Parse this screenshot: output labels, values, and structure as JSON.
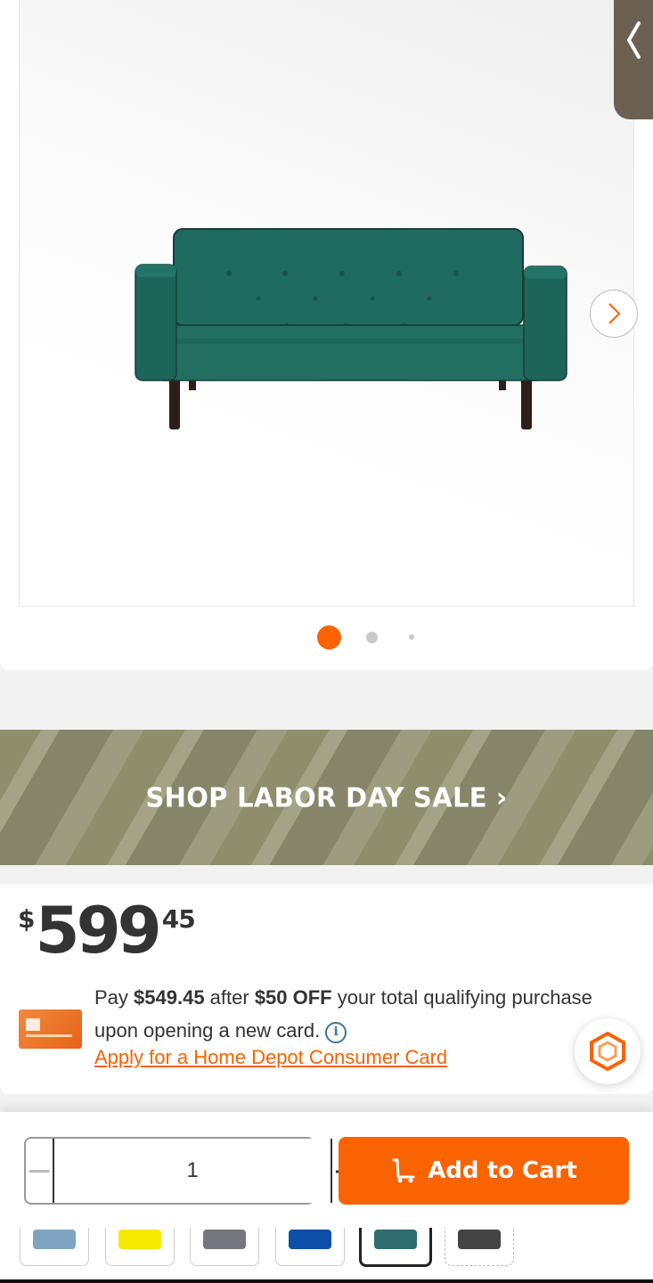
{
  "gallery": {
    "image_alt": "Green velvet sofa",
    "slide_count": 3,
    "active_slide": 1
  },
  "promo": {
    "label": "SHOP LABOR DAY SALE",
    "chevron": "›"
  },
  "price": {
    "dollar_sign": "$",
    "dollars": "599",
    "cents": "45"
  },
  "financing": {
    "line_prefix": "Pay ",
    "discounted_price": "$549.45",
    "line_mid": " after ",
    "discount": "$50 OFF",
    "line_suffix": " your total qualifying purchase upon opening a new card.",
    "info_icon_label": "i",
    "apply_link": "Apply for a Home Depot Consumer Card"
  },
  "cart": {
    "quantity": "1",
    "minus_label": "−",
    "plus_label": "+",
    "add_to_cart_label": "Add to Cart"
  },
  "swatches": [
    {
      "name": "light-blue",
      "color": "#7ea4c4"
    },
    {
      "name": "yellow",
      "color": "#f5e900"
    },
    {
      "name": "gray",
      "color": "#76767e"
    },
    {
      "name": "blue",
      "color": "#0d4ea8"
    },
    {
      "name": "teal",
      "color": "#2e6c6e",
      "selected": true
    },
    {
      "name": "dark-gray",
      "color": "#444444"
    }
  ],
  "colors": {
    "brand_orange": "#f96302",
    "sofa_green": "#1f6b5f",
    "info_blue": "#3e7697"
  }
}
